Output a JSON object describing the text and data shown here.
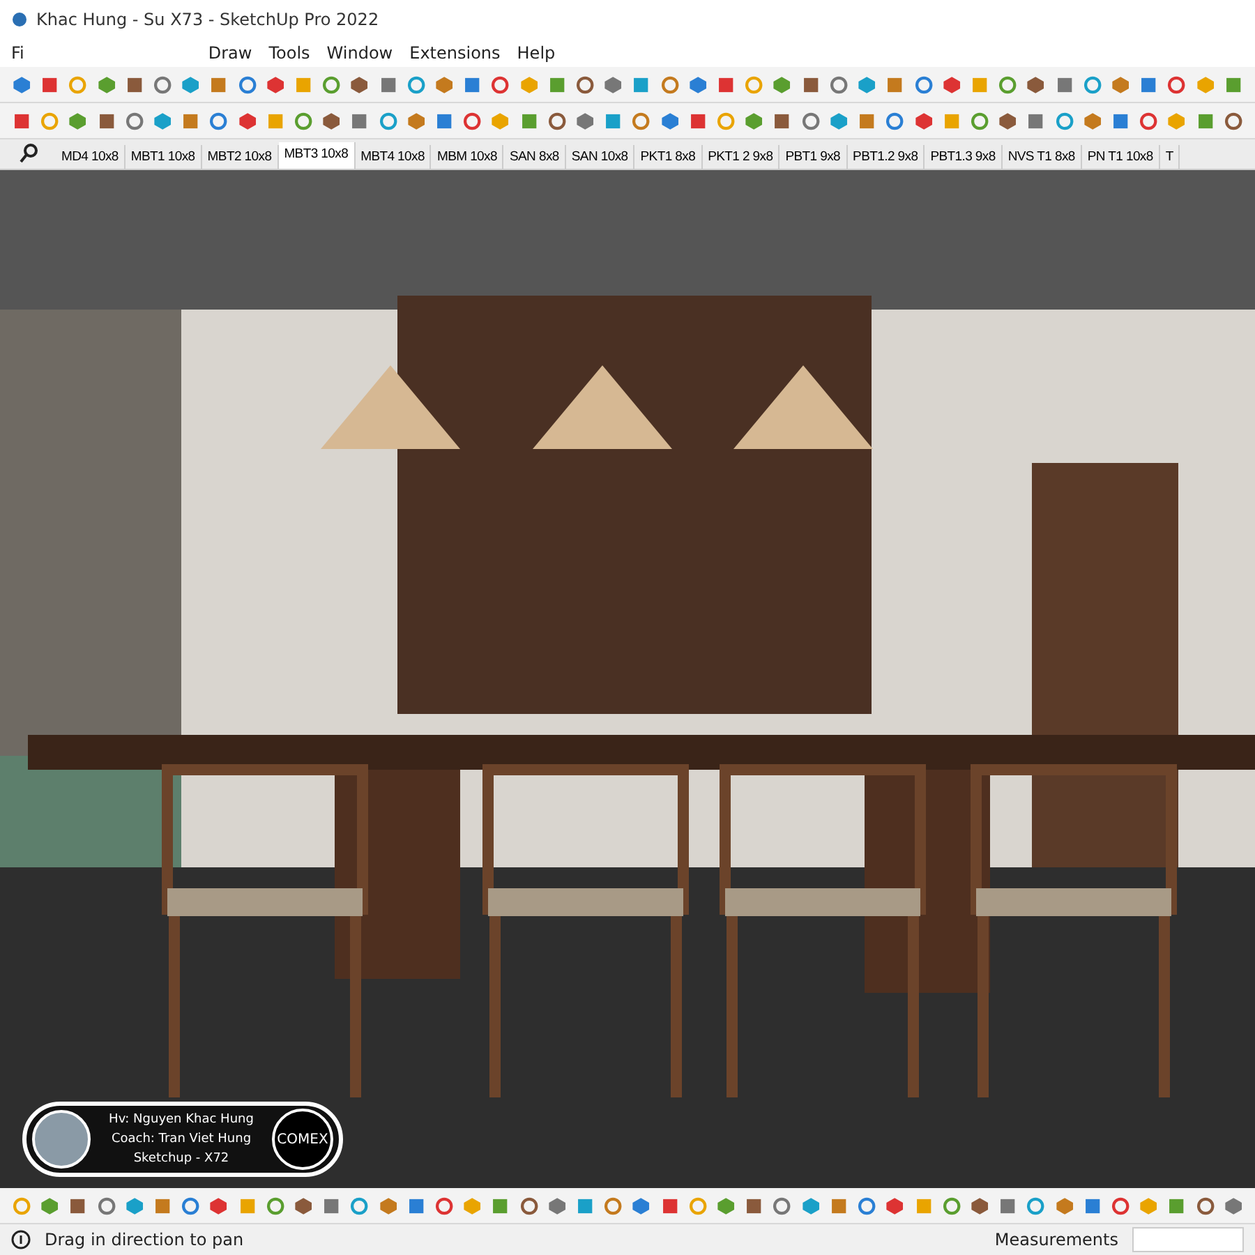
{
  "window": {
    "title": "Khac Hung - Su X73 - SketchUp Pro 2022"
  },
  "menu": [
    "Fi",
    "Draw",
    "Tools",
    "Window",
    "Extensions",
    "Help"
  ],
  "scene_tabs": [
    {
      "label": "MD4 10x8",
      "selected": false
    },
    {
      "label": "MBT1 10x8",
      "selected": false
    },
    {
      "label": "MBT2 10x8",
      "selected": false
    },
    {
      "label": "MBT3 10x8",
      "selected": true
    },
    {
      "label": "MBT4 10x8",
      "selected": false
    },
    {
      "label": "MBM 10x8",
      "selected": false
    },
    {
      "label": "SAN 8x8",
      "selected": false
    },
    {
      "label": "SAN 10x8",
      "selected": false
    },
    {
      "label": "PKT1 8x8",
      "selected": false
    },
    {
      "label": "PKT1 2 9x8",
      "selected": false
    },
    {
      "label": "PBT1 9x8",
      "selected": false
    },
    {
      "label": "PBT1.2 9x8",
      "selected": false
    },
    {
      "label": "PBT1.3 9x8",
      "selected": false
    },
    {
      "label": "NVS T1 8x8",
      "selected": false
    },
    {
      "label": "PN T1 10x8",
      "selected": false
    },
    {
      "label": "T",
      "selected": false
    }
  ],
  "student_card": {
    "lines": [
      "Hv: Nguyen Khac Hung",
      "Coach: Tran Viet Hung",
      "Sketchup - X72"
    ],
    "logo": "COMEX"
  },
  "status_bar": {
    "hint": "Drag in direction to pan",
    "measurements_label": "Measurements"
  }
}
